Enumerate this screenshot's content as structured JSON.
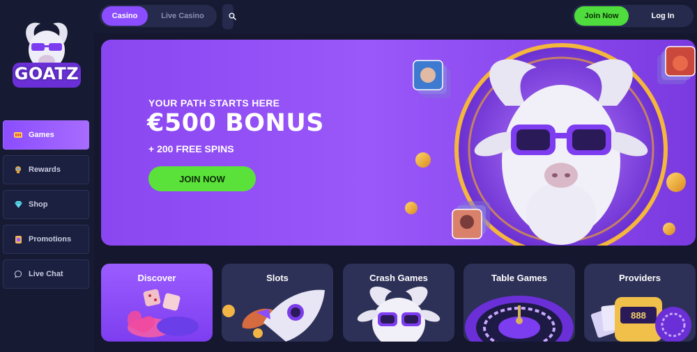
{
  "brand": {
    "name": "GOATZ"
  },
  "sidebar": {
    "items": [
      {
        "label": "Games",
        "icon": "slot-machine-icon",
        "active": true
      },
      {
        "label": "Rewards",
        "icon": "trophy-icon",
        "active": false
      },
      {
        "label": "Shop",
        "icon": "gem-icon",
        "active": false
      },
      {
        "label": "Promotions",
        "icon": "card-icon",
        "active": false
      },
      {
        "label": "Live Chat",
        "icon": "chat-bubble-icon",
        "active": false
      }
    ]
  },
  "topbar": {
    "tabs": [
      {
        "label": "Casino",
        "active": true
      },
      {
        "label": "Live Casino",
        "active": false
      }
    ],
    "join_label": "Join Now",
    "login_label": "Log In"
  },
  "hero": {
    "kicker": "YOUR PATH STARTS HERE",
    "title": "€500 BONUS",
    "subtitle": "+ 200 FREE SPINS",
    "cta": "JOIN NOW"
  },
  "categories": [
    {
      "label": "Discover"
    },
    {
      "label": "Slots"
    },
    {
      "label": "Crash Games"
    },
    {
      "label": "Table Games"
    },
    {
      "label": "Providers"
    }
  ],
  "colors": {
    "background": "#15172e",
    "accent_purple": "#8b4dff",
    "accent_green": "#5be23a",
    "card": "#2d3057"
  }
}
